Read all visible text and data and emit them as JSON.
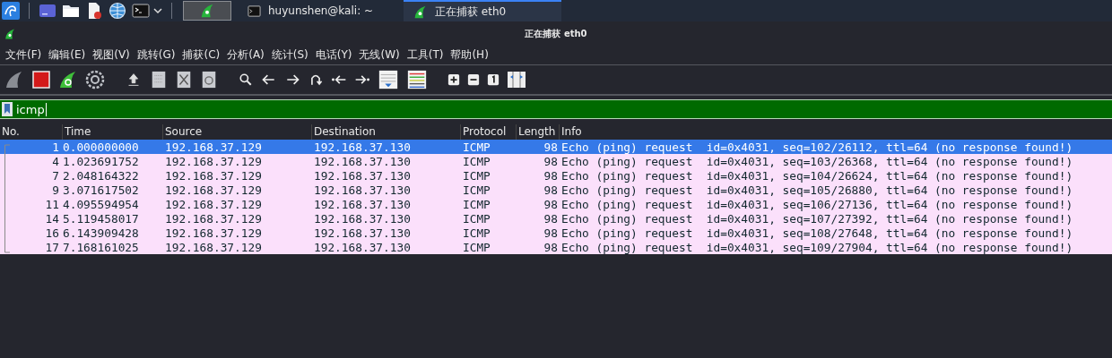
{
  "taskbar": {
    "tasks": [
      {
        "kind": "terminal",
        "label": "huyunshen@kali: ~",
        "selected": false
      },
      {
        "kind": "wireshark",
        "label": "正在捕获 eth0",
        "selected": true
      }
    ]
  },
  "window": {
    "title": "正在捕获 eth0"
  },
  "menu": [
    "文件(F)",
    "编辑(E)",
    "视图(V)",
    "跳转(G)",
    "捕获(C)",
    "分析(A)",
    "统计(S)",
    "电话(Y)",
    "无线(W)",
    "工具(T)",
    "帮助(H)"
  ],
  "filter": {
    "value": "icmp"
  },
  "table": {
    "columns": [
      "No.",
      "Time",
      "Source",
      "Destination",
      "Protocol",
      "Length",
      "Info"
    ],
    "rows": [
      {
        "no": "1",
        "time": "0.000000000",
        "source": "192.168.37.129",
        "destination": "192.168.37.130",
        "protocol": "ICMP",
        "length": "98",
        "info": "Echo (ping) request  id=0x4031, seq=102/26112, ttl=64 (no response found!)",
        "selected": true
      },
      {
        "no": "4",
        "time": "1.023691752",
        "source": "192.168.37.129",
        "destination": "192.168.37.130",
        "protocol": "ICMP",
        "length": "98",
        "info": "Echo (ping) request  id=0x4031, seq=103/26368, ttl=64 (no response found!)",
        "selected": false
      },
      {
        "no": "7",
        "time": "2.048164322",
        "source": "192.168.37.129",
        "destination": "192.168.37.130",
        "protocol": "ICMP",
        "length": "98",
        "info": "Echo (ping) request  id=0x4031, seq=104/26624, ttl=64 (no response found!)",
        "selected": false
      },
      {
        "no": "9",
        "time": "3.071617502",
        "source": "192.168.37.129",
        "destination": "192.168.37.130",
        "protocol": "ICMP",
        "length": "98",
        "info": "Echo (ping) request  id=0x4031, seq=105/26880, ttl=64 (no response found!)",
        "selected": false
      },
      {
        "no": "11",
        "time": "4.095594954",
        "source": "192.168.37.129",
        "destination": "192.168.37.130",
        "protocol": "ICMP",
        "length": "98",
        "info": "Echo (ping) request  id=0x4031, seq=106/27136, ttl=64 (no response found!)",
        "selected": false
      },
      {
        "no": "14",
        "time": "5.119458017",
        "source": "192.168.37.129",
        "destination": "192.168.37.130",
        "protocol": "ICMP",
        "length": "98",
        "info": "Echo (ping) request  id=0x4031, seq=107/27392, ttl=64 (no response found!)",
        "selected": false
      },
      {
        "no": "16",
        "time": "6.143909428",
        "source": "192.168.37.129",
        "destination": "192.168.37.130",
        "protocol": "ICMP",
        "length": "98",
        "info": "Echo (ping) request  id=0x4031, seq=108/27648, ttl=64 (no response found!)",
        "selected": false
      },
      {
        "no": "17",
        "time": "7.168161025",
        "source": "192.168.37.129",
        "destination": "192.168.37.130",
        "protocol": "ICMP",
        "length": "98",
        "info": "Echo (ping) request  id=0x4031, seq=109/27904, ttl=64 (no response found!)",
        "selected": false
      }
    ]
  }
}
